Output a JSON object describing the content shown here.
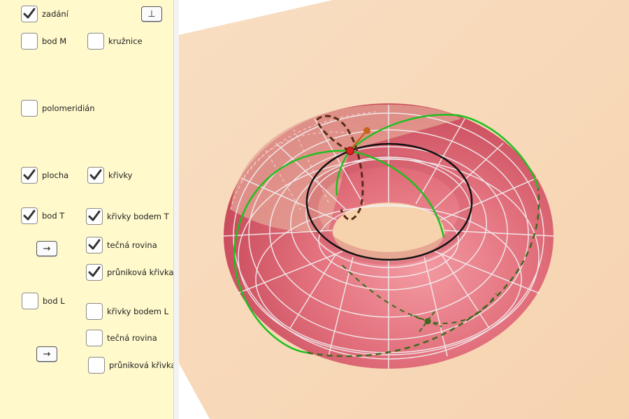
{
  "panel": {
    "top_button": "⊥",
    "arrow_button_T": "→",
    "arrow_button_L": "→",
    "checkboxes": {
      "zadani": {
        "label": "zadání",
        "checked": true
      },
      "bod_m": {
        "label": "bod M",
        "checked": false
      },
      "kruznice": {
        "label": "kružnice",
        "checked": false
      },
      "polomeridian": {
        "label": "polomeridián",
        "checked": false
      },
      "plocha": {
        "label": "plocha",
        "checked": true
      },
      "krivky": {
        "label": "křivky",
        "checked": true
      },
      "bod_t": {
        "label": "bod T",
        "checked": true
      },
      "krivky_bodem_t": {
        "label": "křivky bodem T",
        "checked": true
      },
      "tecna_rovina_t": {
        "label": "tečná rovina",
        "checked": true
      },
      "prunikova_krivka_t": {
        "label": "průniková křivka",
        "checked": true
      },
      "bod_l": {
        "label": "bod L",
        "checked": false
      },
      "krivky_bodem_l": {
        "label": "křivky bodem L",
        "checked": false
      },
      "tecna_rovina_l": {
        "label": "tečná rovina",
        "checked": false
      },
      "prunikova_krivka_l": {
        "label": "průniková křivka",
        "checked": false
      }
    }
  },
  "view3d": {
    "colors": {
      "plane": "#f6d3ad",
      "torus": "#e2707c",
      "green_curve": "#1fbf1f",
      "black_circle": "#111111",
      "dashed_curve": "#5a2a14",
      "point_T": "#dd2222",
      "tangent_vector": "#c8641e",
      "point_L": "#3c6a1e"
    }
  }
}
